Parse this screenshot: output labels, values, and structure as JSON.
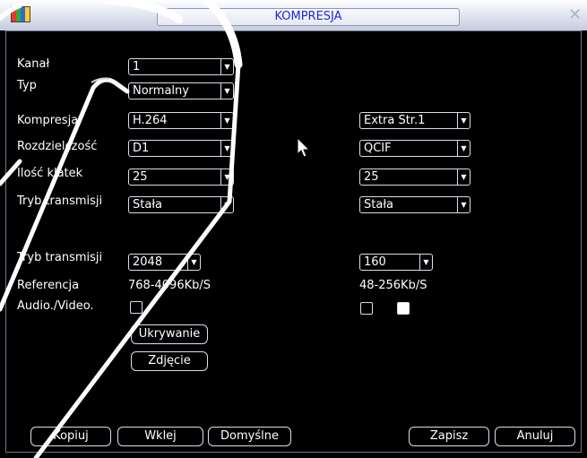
{
  "window": {
    "title": "KOMPRESJA"
  },
  "form": {
    "rows": [
      {
        "label": "Kanał",
        "main": "1",
        "extra": ""
      },
      {
        "label": "Typ",
        "main": "Normalny",
        "extra": ""
      },
      {
        "label": "Kompresja",
        "main": "H.264",
        "extra": "Extra Str.1"
      },
      {
        "label": "Rozdzielczość",
        "main": "D1",
        "extra": "QCIF"
      },
      {
        "label": "Ilość klatek",
        "main": "25",
        "extra": "25"
      },
      {
        "label": "Tryb transmisji",
        "main": "Stała",
        "extra": "Stała"
      }
    ],
    "bitrate": {
      "label": "Tryb transmisji",
      "main": "2048",
      "extra": "160"
    },
    "reference": {
      "label": "Referencja",
      "main": "768-4096Kb/S",
      "extra": "48-256Kb/S"
    },
    "audio_video": {
      "label": "Audio./Video.",
      "main_checked": false,
      "extra1_checked": false,
      "extra2_checked": true
    }
  },
  "buttons": {
    "mask": "Ukrywanie",
    "snapshot": "Zdjęcie",
    "copy": "Kopiuj",
    "paste": "Wklej",
    "default": "Domyślne",
    "save": "Zapisz",
    "cancel": "Anuluj"
  },
  "colors": {
    "accent_title": "#1a2ad8",
    "background": "#000000",
    "frame": "#d8def0"
  }
}
